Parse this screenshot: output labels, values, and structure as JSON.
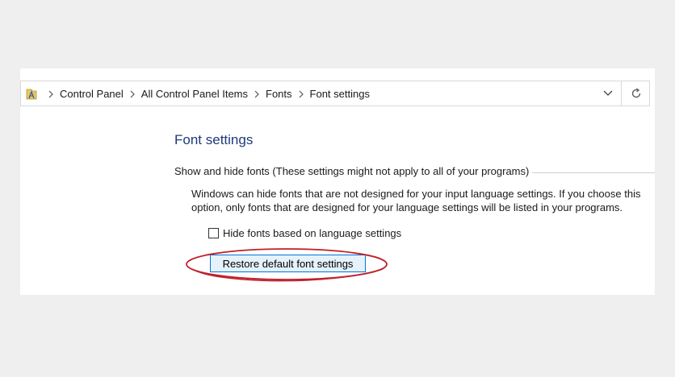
{
  "address_bar": {
    "icon": "fonts-folder-icon",
    "breadcrumbs": [
      "Control Panel",
      "All Control Panel Items",
      "Fonts",
      "Font settings"
    ],
    "dropdown_icon": "chevron-down-icon",
    "refresh_icon": "refresh-icon"
  },
  "content": {
    "title": "Font settings",
    "group_header": "Show and hide fonts (These settings might not apply to all of your programs)",
    "description": "Windows can hide fonts that are not designed for your input language settings. If you choose this option, only fonts that are designed for your language settings will be listed in your programs.",
    "checkbox": {
      "label": "Hide fonts based on language settings",
      "checked": false
    },
    "restore_button_label": "Restore default font settings"
  },
  "colors": {
    "title": "#1e3a7a",
    "button_bg": "#e5f1fb",
    "button_border": "#0078d7",
    "highlight_ellipse": "#c0202a"
  }
}
